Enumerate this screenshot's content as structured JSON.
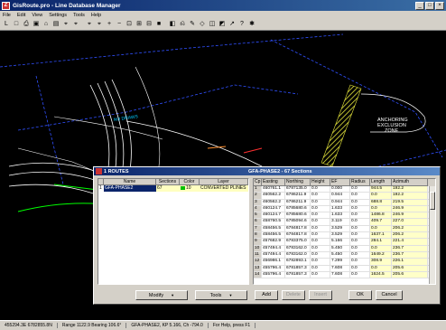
{
  "window": {
    "title": "GisRoute.pro - Line Database Manager",
    "controls": [
      "_",
      "□",
      "×"
    ]
  },
  "menu": [
    "File",
    "Edit",
    "View",
    "Settings",
    "Tools",
    "Help"
  ],
  "toolbar": [
    "L",
    "□",
    "⎙",
    "▣",
    "⌂",
    "▤",
    "⌖",
    "⌖",
    "⌖",
    "⌖",
    "+",
    "−",
    "⊡",
    "⊞",
    "⊟",
    "■",
    "◧",
    "⎌",
    "✎",
    "◇",
    "◫",
    "◩",
    "↗",
    "?",
    "✱"
  ],
  "map": {
    "labels": [
      {
        "text": "NO DRAWS"
      },
      {
        "text": "ANCHORING"
      },
      {
        "text": "EXCLUSION"
      },
      {
        "text": "ZONE"
      }
    ]
  },
  "dialog": {
    "title": "1 ROUTES",
    "subtitle": "GFA-PHASE2 - 67 Sections",
    "routes_headers": [
      "",
      "Name",
      "Sections",
      "Color",
      "Layer"
    ],
    "routes": [
      {
        "idx": "1",
        "name": "GFA-PHASE2",
        "sections": "67",
        "color": "10",
        "layer": "CONVERTED PLINES"
      }
    ],
    "grid_headers": [
      "Cp",
      "Easting",
      "Northing",
      "Height",
      "EF",
      "Radius",
      "Length",
      "Azimuth"
    ],
    "grid_rows": [
      [
        "1",
        "460761.1",
        "6787135.0",
        "0.0",
        "0.000",
        "0.0",
        "944.5",
        "192.2"
      ],
      [
        "2",
        "460562.2",
        "6786211.9",
        "0.0",
        "0.944",
        "0.0",
        "0.0",
        "192.2"
      ],
      [
        "3",
        "460562.2",
        "6786211.9",
        "0.0",
        "0.944",
        "0.0",
        "688.8",
        "219.5"
      ],
      [
        "4",
        "460124.7",
        "6785680.6",
        "0.0",
        "1.633",
        "0.0",
        "0.0",
        "246.9"
      ],
      [
        "5",
        "460124.7",
        "6785680.6",
        "0.0",
        "1.633",
        "0.0",
        "1486.8",
        "246.9"
      ],
      [
        "6",
        "458760.5",
        "6785094.6",
        "0.0",
        "3.119",
        "0.0",
        "409.7",
        "227.0"
      ],
      [
        "7",
        "458456.5",
        "6784817.8",
        "0.0",
        "3.529",
        "0.0",
        "0.0",
        "206.2"
      ],
      [
        "8",
        "458456.5",
        "6784817.8",
        "0.0",
        "3.529",
        "0.0",
        "1637.1",
        "206.2"
      ],
      [
        "9",
        "457682.9",
        "6783375.0",
        "0.0",
        "5.166",
        "0.0",
        "284.1",
        "221.4"
      ],
      [
        "10",
        "457494.4",
        "6783162.0",
        "0.0",
        "5.450",
        "0.0",
        "0.0",
        "236.7"
      ],
      [
        "11",
        "457494.4",
        "6783162.0",
        "0.0",
        "5.450",
        "0.0",
        "1649.2",
        "236.7"
      ],
      [
        "12",
        "456986.1",
        "6782893.1",
        "0.0",
        "7.299",
        "0.0",
        "308.9",
        "226.1"
      ],
      [
        "13",
        "455796.4",
        "6781857.3",
        "0.0",
        "7.608",
        "0.0",
        "0.0",
        "205.6"
      ],
      [
        "14",
        "455796.4",
        "6781857.3",
        "0.0",
        "7.608",
        "0.0",
        "1624.5",
        "205.6"
      ]
    ],
    "buttons": {
      "modify": "Modify",
      "tools": "Tools",
      "add": "Add",
      "delete": "Delete",
      "insert": "Insert",
      "ok": "OK",
      "cancel": "Cancel"
    }
  },
  "status": {
    "coords": "455294.3E 6782855.8N",
    "range": "Range 1122.9 Bearing 106.6°",
    "section": "GFA-PHASE2, KP 5.166, Ch -794.0",
    "help": "For Help, press F1"
  },
  "colors": {
    "canvas_bg": "#000000",
    "route_green": "#00ff00",
    "hatch_yellow": "#e6e63c",
    "line_white": "#ffffff",
    "text_cyan": "#00c8ff"
  }
}
